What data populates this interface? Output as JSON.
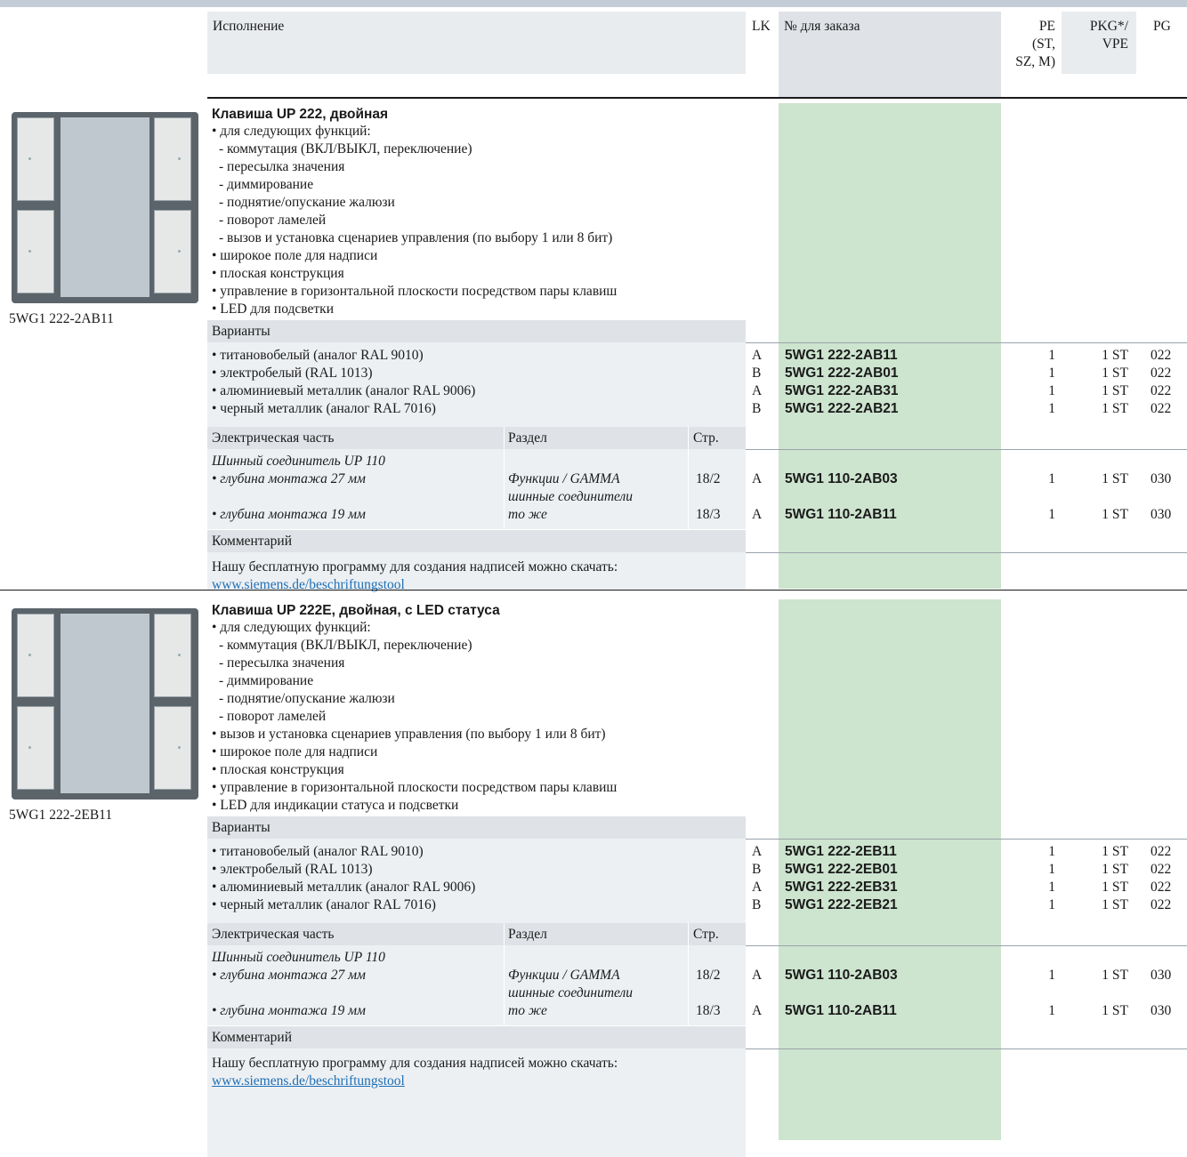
{
  "header": {
    "col_desc": "Исполнение",
    "col_lk": "LK",
    "col_order": "№ для заказа",
    "col_pe": [
      "PE",
      "(ST,",
      "SZ, M)"
    ],
    "col_pkg": [
      "PKG*/",
      "VPE"
    ],
    "col_pg": "PG"
  },
  "sections": [
    {
      "image_caption": "5WG1 222-2AB11",
      "title": "Клавиша UP 222, двойная",
      "features": [
        "• для следующих функций:",
        "  - коммутация (ВКЛ/ВЫКЛ, переключение)",
        "  - пересылка значения",
        "  - диммирование",
        "  - поднятие/опускание жалюзи",
        "  - поворот ламелей",
        "  - вызов и установка сценариев управления (по выбору 1 или 8 бит)",
        "• широкое поле для надписи",
        "• плоская конструкция",
        "• управление в горизонтальной плоскости посредством пары клавиш",
        "• LED для подсветки"
      ],
      "variants_label": "Варианты",
      "variants": [
        {
          "desc": "• титановобелый (аналог RAL 9010)",
          "lk": "A",
          "order": "5WG1 222-2AB11",
          "pe": "1",
          "pkg": "1 ST",
          "pg": "022"
        },
        {
          "desc": "• электробелый (RAL 1013)",
          "lk": "B",
          "order": "5WG1 222-2AB01",
          "pe": "1",
          "pkg": "1 ST",
          "pg": "022"
        },
        {
          "desc": "• алюминиевый металлик (аналог RAL 9006)",
          "lk": "A",
          "order": "5WG1 222-2AB31",
          "pe": "1",
          "pkg": "1 ST",
          "pg": "022"
        },
        {
          "desc": "• черный металлик (аналог RAL 7016)",
          "lk": "B",
          "order": "5WG1 222-2AB21",
          "pe": "1",
          "pkg": "1 ST",
          "pg": "022"
        }
      ],
      "electrical_label": "Электрическая часть",
      "section_label": "Раздел",
      "page_label": "Стр.",
      "connector_title": "Шинный соединитель UP 110",
      "connectors": [
        {
          "desc": "• глубина монтажа 27 мм",
          "section": "Функции / GAMMA",
          "section2": "шинные соединители",
          "page": "18/2",
          "lk": "A",
          "order": "5WG1 110-2AB03",
          "pe": "1",
          "pkg": "1 ST",
          "pg": "030"
        },
        {
          "desc": "• глубина монтажа 19 мм",
          "section": "то же",
          "section2": "",
          "page": "18/3",
          "lk": "A",
          "order": "5WG1 110-2AB11",
          "pe": "1",
          "pkg": "1 ST",
          "pg": "030"
        }
      ],
      "comment_label": "Комментарий",
      "comment_text": "Нашу бесплатную программу для создания надписей можно скачать:",
      "comment_link": "www.siemens.de/beschriftungstool"
    },
    {
      "image_caption": "5WG1 222-2EB11",
      "title": "Клавиша UP 222E, двойная, с LED статуса",
      "features": [
        "• для следующих функций:",
        "  - коммутация (ВКЛ/ВЫКЛ, переключение)",
        "  - пересылка значения",
        "  - диммирование",
        "  - поднятие/опускание жалюзи",
        "  - поворот ламелей",
        "• вызов и установка сценариев управления (по выбору 1 или 8 бит)",
        "• широкое поле для надписи",
        "• плоская конструкция",
        "• управление в горизонтальной плоскости посредством пары клавиш",
        "• LED для индикации статуса и подсветки"
      ],
      "variants_label": "Варианты",
      "variants": [
        {
          "desc": "• титановобелый (аналог RAL 9010)",
          "lk": "A",
          "order": "5WG1 222-2EB11",
          "pe": "1",
          "pkg": "1 ST",
          "pg": "022"
        },
        {
          "desc": "• электробелый (RAL 1013)",
          "lk": "B",
          "order": "5WG1 222-2EB01",
          "pe": "1",
          "pkg": "1 ST",
          "pg": "022"
        },
        {
          "desc": "• алюминиевый металлик (аналог RAL 9006)",
          "lk": "A",
          "order": "5WG1 222-2EB31",
          "pe": "1",
          "pkg": "1 ST",
          "pg": "022"
        },
        {
          "desc": "• черный металлик (аналог RAL 7016)",
          "lk": "B",
          "order": "5WG1 222-2EB21",
          "pe": "1",
          "pkg": "1 ST",
          "pg": "022"
        }
      ],
      "electrical_label": "Электрическая часть",
      "section_label": "Раздел",
      "page_label": "Стр.",
      "connector_title": "Шинный соединитель UP 110",
      "connectors": [
        {
          "desc": "• глубина монтажа 27 мм",
          "section": "Функции / GAMMA",
          "section2": "шинные соединители",
          "page": "18/2",
          "lk": "A",
          "order": "5WG1 110-2AB03",
          "pe": "1",
          "pkg": "1 ST",
          "pg": "030"
        },
        {
          "desc": "• глубина монтажа 19 мм",
          "section": "то же",
          "section2": "",
          "page": "18/3",
          "lk": "A",
          "order": "5WG1 110-2AB11",
          "pe": "1",
          "pkg": "1 ST",
          "pg": "030"
        }
      ],
      "comment_label": "Комментарий",
      "comment_text": "Нашу бесплатную программу для создания надписей можно скачать:",
      "comment_link": "www.siemens.de/beschriftungstool"
    }
  ]
}
